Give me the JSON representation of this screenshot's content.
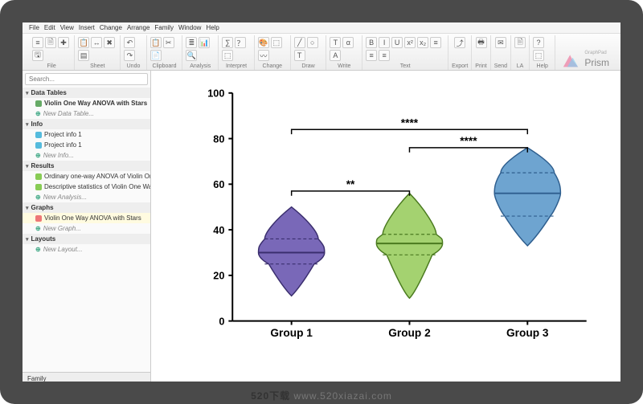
{
  "menu": [
    "File",
    "Edit",
    "View",
    "Insert",
    "Change",
    "Arrange",
    "Family",
    "Window",
    "Help"
  ],
  "ribbon_groups": [
    {
      "label": "File",
      "icons": [
        "≡",
        "🗎",
        "✚",
        "🖫"
      ]
    },
    {
      "label": "Sheet",
      "icons": [
        "📋",
        "↔",
        "✖",
        "▤"
      ]
    },
    {
      "label": "Undo",
      "icons": [
        "↶",
        "↷"
      ]
    },
    {
      "label": "Clipboard",
      "icons": [
        "📋",
        "✂",
        "📄"
      ]
    },
    {
      "label": "Analysis",
      "icons": [
        "≣",
        "📊",
        "🔍"
      ]
    },
    {
      "label": "Interpret",
      "icons": [
        "∑",
        "？",
        "⬚"
      ]
    },
    {
      "label": "Change",
      "icons": [
        "🎨",
        "⬚",
        "〰"
      ]
    },
    {
      "label": "Draw",
      "icons": [
        "╱",
        "○",
        "T"
      ]
    },
    {
      "label": "Write",
      "icons": [
        "T",
        "α",
        "A"
      ]
    },
    {
      "label": "Text",
      "icons": [
        "B",
        "I",
        "U",
        "x²",
        "x₂",
        "≡",
        "≡",
        "≡"
      ]
    },
    {
      "label": "Export",
      "icons": [
        "⤴"
      ]
    },
    {
      "label": "Print",
      "icons": [
        "🖶"
      ]
    },
    {
      "label": "Send",
      "icons": [
        "✉"
      ]
    },
    {
      "label": "LA",
      "icons": [
        "🗎"
      ]
    },
    {
      "label": "Help",
      "icons": [
        "?",
        "⬚"
      ]
    }
  ],
  "brand": {
    "name": "Prism",
    "sub": "GraphPad"
  },
  "search": {
    "placeholder": "Search..."
  },
  "sidebar": {
    "sections": [
      {
        "title": "Data Tables",
        "items": [
          {
            "icon": "#6a6",
            "label": "Violin One Way ANOVA with Stars",
            "bold": true
          },
          {
            "icon": "plus",
            "label": "New Data Table..."
          }
        ]
      },
      {
        "title": "Info",
        "items": [
          {
            "icon": "#5bd",
            "label": "Project info 1"
          },
          {
            "icon": "#5bd",
            "label": "Project info 1"
          },
          {
            "icon": "plus",
            "label": "New Info..."
          }
        ]
      },
      {
        "title": "Results",
        "items": [
          {
            "icon": "#8c5",
            "label": "Ordinary one-way ANOVA of Violin One..."
          },
          {
            "icon": "#8c5",
            "label": "Descriptive statistics of Violin One Way AN..."
          },
          {
            "icon": "plus",
            "label": "New Analysis..."
          }
        ]
      },
      {
        "title": "Graphs",
        "items": [
          {
            "icon": "#e77",
            "label": "Violin One Way ANOVA with Stars",
            "sel": true
          },
          {
            "icon": "plus",
            "label": "New Graph..."
          }
        ]
      },
      {
        "title": "Layouts",
        "items": [
          {
            "icon": "plus",
            "label": "New Layout..."
          }
        ]
      }
    ],
    "family_label": "Family"
  },
  "chart_data": {
    "type": "violin",
    "categories": [
      "Group 1",
      "Group 2",
      "Group 3"
    ],
    "ylim": [
      0,
      100
    ],
    "yticks": [
      0,
      20,
      40,
      60,
      80,
      100
    ],
    "series": [
      {
        "name": "Group 1",
        "median": 30,
        "q1": 25,
        "q3": 36,
        "min": 11,
        "max": 50,
        "color": "#7968b8",
        "stroke": "#3a2e6e"
      },
      {
        "name": "Group 2",
        "median": 34,
        "q1": 29,
        "q3": 38,
        "min": 10,
        "max": 56,
        "color": "#a4d270",
        "stroke": "#4a7a1f"
      },
      {
        "name": "Group 3",
        "median": 56,
        "q1": 46,
        "q3": 65,
        "min": 33,
        "max": 76,
        "color": "#6ea4d0",
        "stroke": "#2e5e8e"
      }
    ],
    "significance": [
      {
        "from": 0,
        "to": 1,
        "label": "**",
        "y": 57
      },
      {
        "from": 0,
        "to": 2,
        "label": "****",
        "y": 84
      },
      {
        "from": 1,
        "to": 2,
        "label": "****",
        "y": 76
      }
    ]
  },
  "watermark": {
    "prefix": "520下载 ",
    "url": "www.520xiazai.com"
  }
}
